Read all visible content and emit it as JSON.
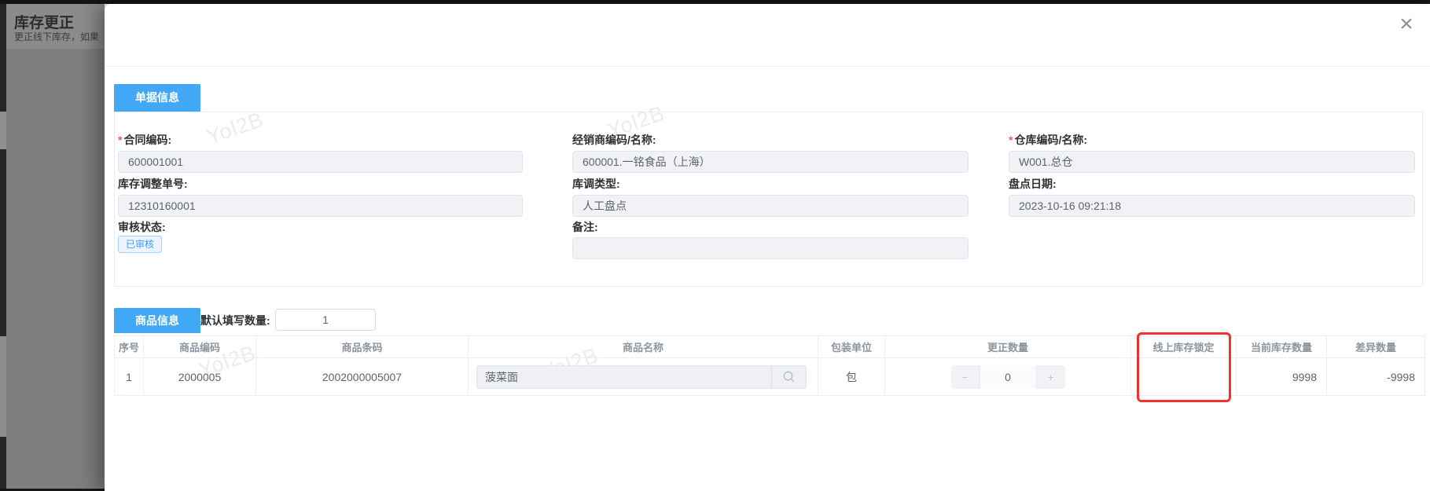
{
  "backdrop": {
    "title": "库存更正",
    "subtitle": "更正线下库存，如果"
  },
  "modal": {
    "close_glyph": "×"
  },
  "watermark": {
    "text": "Yol2B"
  },
  "doc_info": {
    "tab_label": "单据信息",
    "required_mark": "*",
    "fields": {
      "contract_code": {
        "label": "合同编码:",
        "value": "600001001"
      },
      "dealer": {
        "label": "经销商编码/名称:",
        "value": "600001.一铭食品（上海）"
      },
      "warehouse": {
        "label": "仓库编码/名称:",
        "value": "W001.总仓"
      },
      "adjust_no": {
        "label": "库存调整单号:",
        "value": "12310160001"
      },
      "adjust_type": {
        "label": "库调类型:",
        "value": "人工盘点"
      },
      "check_date": {
        "label": "盘点日期:",
        "value": "2023-10-16 09:21:18"
      },
      "audit_status": {
        "label": "审核状态:",
        "badge": "已审核"
      },
      "remark": {
        "label": "备注:",
        "value": ""
      }
    }
  },
  "product_info": {
    "tab_label": "商品信息",
    "default_qty_label": "默认填写数量:",
    "default_qty_value": "1",
    "table": {
      "headers": [
        "序号",
        "商品编码",
        "商品条码",
        "商品名称",
        "包装单位",
        "更正数量",
        "线上库存锁定",
        "当前库存数量",
        "差异数量"
      ],
      "row": {
        "seq": "1",
        "product_code": "2000005",
        "barcode": "2002000005007",
        "product_name": "菠菜面",
        "unit": "包",
        "correct_qty": "0",
        "online_stock_lock": "",
        "current_stock": "9998",
        "diff_qty": "-9998"
      },
      "stepper": {
        "minus": "−",
        "plus": "+"
      }
    }
  },
  "colors": {
    "accent_blue": "#41a8f5",
    "highlight_red": "#f2302e",
    "badge_text": "#409eff",
    "badge_bg": "#ecf5ff",
    "badge_border": "#a0cfff"
  }
}
